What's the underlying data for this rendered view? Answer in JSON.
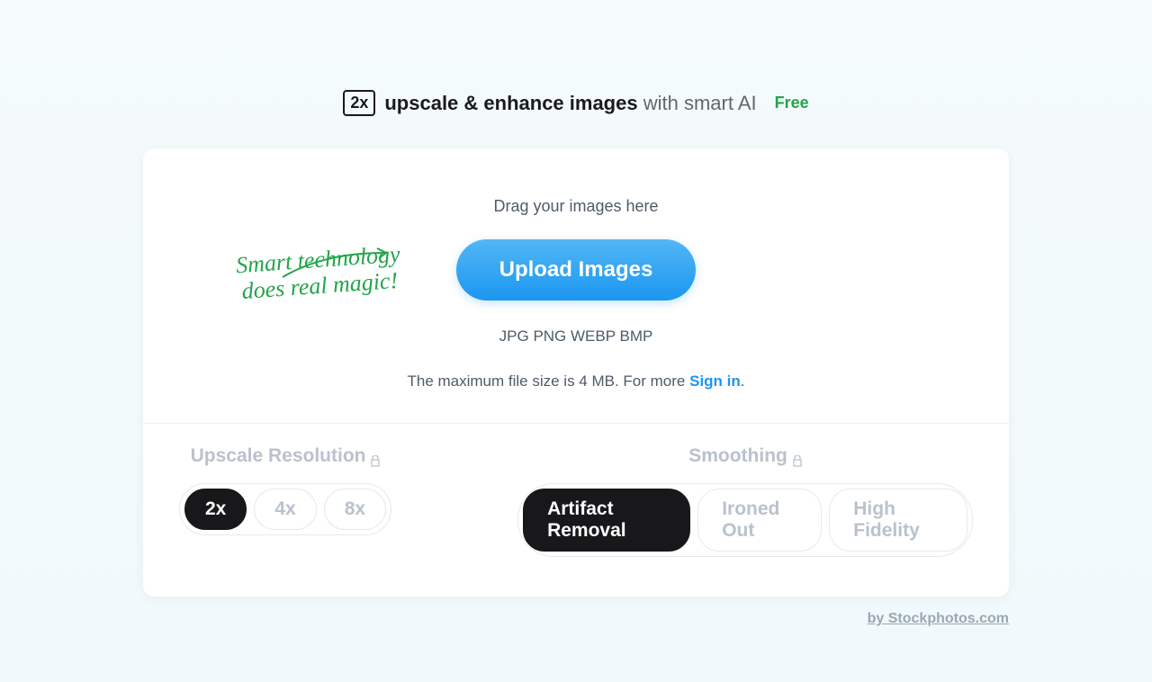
{
  "header": {
    "logo_text": "2x",
    "title_bold": "upscale & enhance images",
    "title_light": " with smart AI",
    "free_label": "Free"
  },
  "handwritten": {
    "line1": "Smart technology",
    "line2": "does real magic!"
  },
  "upload": {
    "drag_text": "Drag your images here",
    "button_label": "Upload Images",
    "formats": "JPG PNG WEBP BMP",
    "filesize_prefix": "The maximum file size is 4 MB. For more ",
    "signin_label": "Sign in",
    "filesize_suffix": "."
  },
  "options": {
    "resolution_label": "Upscale Resolution",
    "smoothing_label": "Smoothing",
    "resolution_values": [
      "2x",
      "4x",
      "8x"
    ],
    "smoothing_values": [
      "Artifact Removal",
      "Ironed Out",
      "High Fidelity"
    ]
  },
  "attribution": "by Stockphotos.com"
}
